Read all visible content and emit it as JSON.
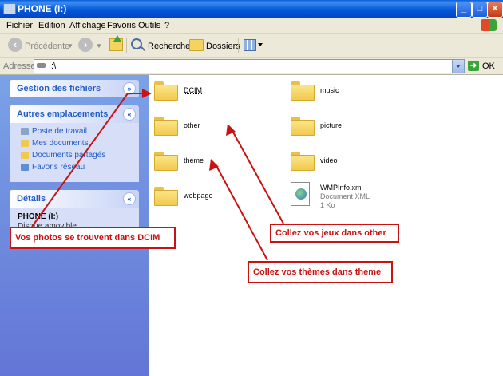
{
  "window": {
    "title": "PHONE (I:)",
    "minimize": "_",
    "maximize": "□",
    "close": "✕"
  },
  "menu": {
    "items": [
      "Fichier",
      "Edition",
      "Affichage",
      "Favoris",
      "Outils",
      "?"
    ]
  },
  "toolbar": {
    "back_label": "Précédente",
    "search_label": "Rechercher",
    "folders_label": "Dossiers"
  },
  "address": {
    "label": "Adresse",
    "value": "I:\\",
    "go_label": "OK"
  },
  "sidebar": {
    "file_tasks_title": "Gestion des fichiers",
    "other_places_title": "Autres emplacements",
    "other_places": [
      "Poste de travail",
      "Mes documents",
      "Documents partagés",
      "Favoris réseau"
    ],
    "details_title": "Détails",
    "details_name": "PHONE (I:)",
    "details_sub": "Disque amovible"
  },
  "content": {
    "items": [
      {
        "name": "DCIM",
        "type": "folder"
      },
      {
        "name": "other",
        "type": "folder"
      },
      {
        "name": "theme",
        "type": "folder"
      },
      {
        "name": "webpage",
        "type": "folder"
      },
      {
        "name": "music",
        "type": "folder"
      },
      {
        "name": "picture",
        "type": "folder"
      },
      {
        "name": "video",
        "type": "folder"
      },
      {
        "name": "WMPInfo.xml",
        "type": "file",
        "kind": "Document XML",
        "size": "1 Ko"
      }
    ]
  },
  "annotations": {
    "dcim": "Vos photos se trouvent dans DCIM",
    "other": "Collez vos jeux dans other",
    "theme": "Collez vos thèmes dans theme"
  },
  "colors": {
    "title_bar": "#0458d6",
    "sidebar": "#7ba2e7",
    "link": "#215dc6",
    "callout": "#cc1111"
  }
}
